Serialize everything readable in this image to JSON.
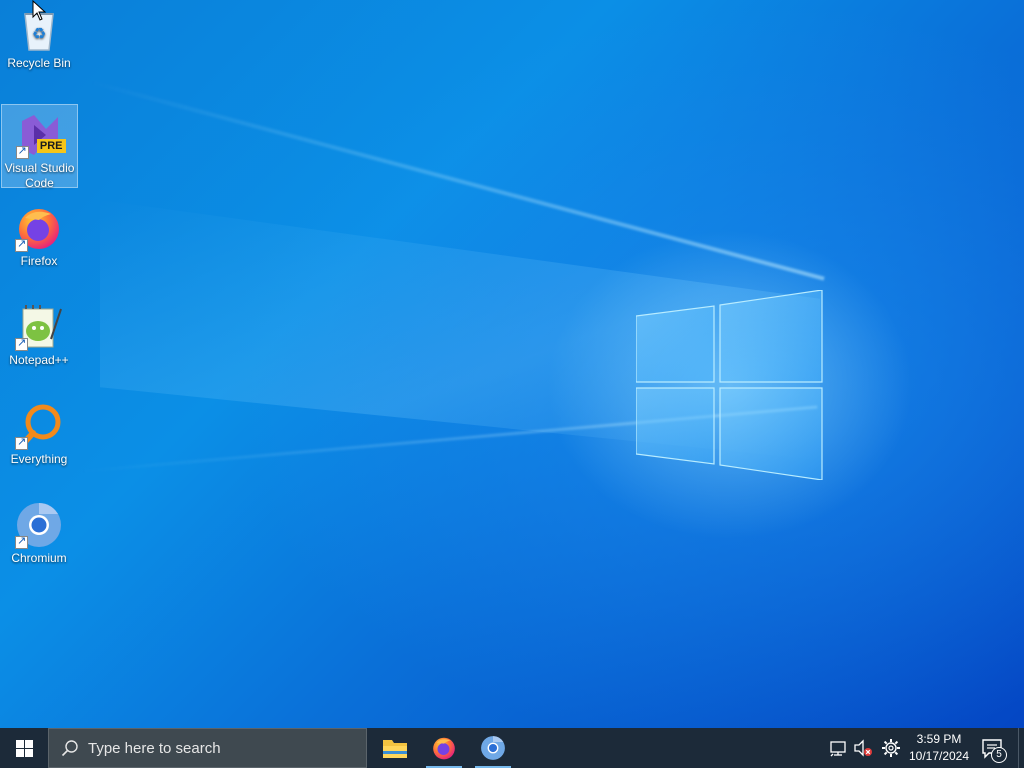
{
  "desktop": {
    "icons": [
      {
        "label": "Recycle Bin"
      },
      {
        "label": "Visual Studio Code",
        "badge": "PRE"
      },
      {
        "label": "Firefox"
      },
      {
        "label": "Notepad++"
      },
      {
        "label": "Everything"
      },
      {
        "label": "Chromium"
      }
    ]
  },
  "taskbar": {
    "search_placeholder": "Type here to search",
    "pinned": [
      "file-explorer",
      "firefox",
      "chromium"
    ],
    "clock": {
      "time": "3:59 PM",
      "date": "10/17/2024"
    },
    "notification_count": "5"
  },
  "colors": {
    "taskbar": "#1c2a39",
    "search_box": "#3f4950",
    "running_indicator": "#76b9ed",
    "desktop_blue": "#0a7fd8"
  }
}
